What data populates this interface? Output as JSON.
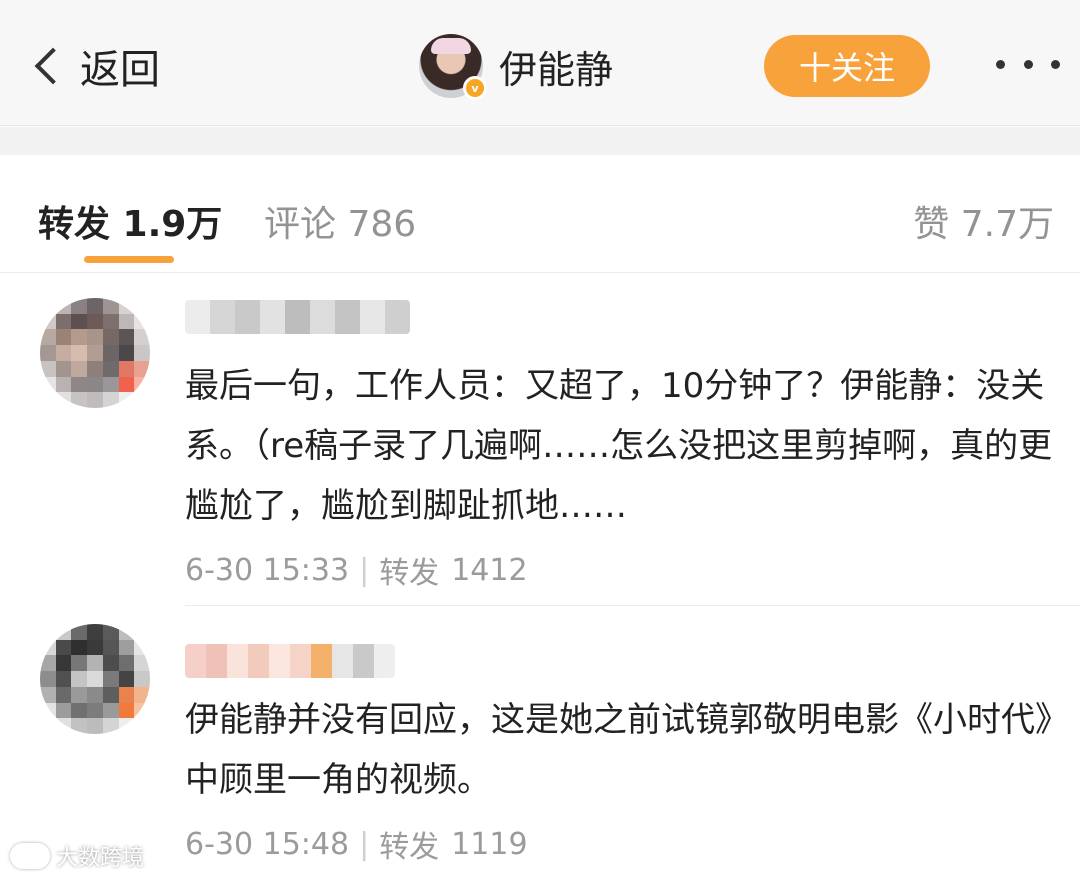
{
  "header": {
    "back_label": "返回",
    "profile_name": "伊能静",
    "verified_badge": "v",
    "follow_label": "十关注",
    "more_icon": "more-dots-icon"
  },
  "tabs": {
    "repost": "转发 1.9万",
    "comment": "评论 786",
    "like": "赞 7.7万"
  },
  "colors": {
    "accent": "#f8a23b",
    "verified": "#f6a623"
  },
  "reposts": [
    {
      "text": "最后一句，工作人员：又超了，10分钟了？伊能静：没关系。（re稿子录了几遍啊……怎么没把这里剪掉啊，真的更尴尬了，尴尬到脚趾抓地……",
      "time": "6-30 15:33",
      "repost_label": "转发",
      "repost_count": "1412"
    },
    {
      "text": "伊能静并没有回应，这是她之前试镜郭敬明电影《小时代》中顾里一角的视频。",
      "time": "6-30 15:48",
      "repost_label": "转发",
      "repost_count": "1119"
    }
  ],
  "watermark": "大数跨境"
}
